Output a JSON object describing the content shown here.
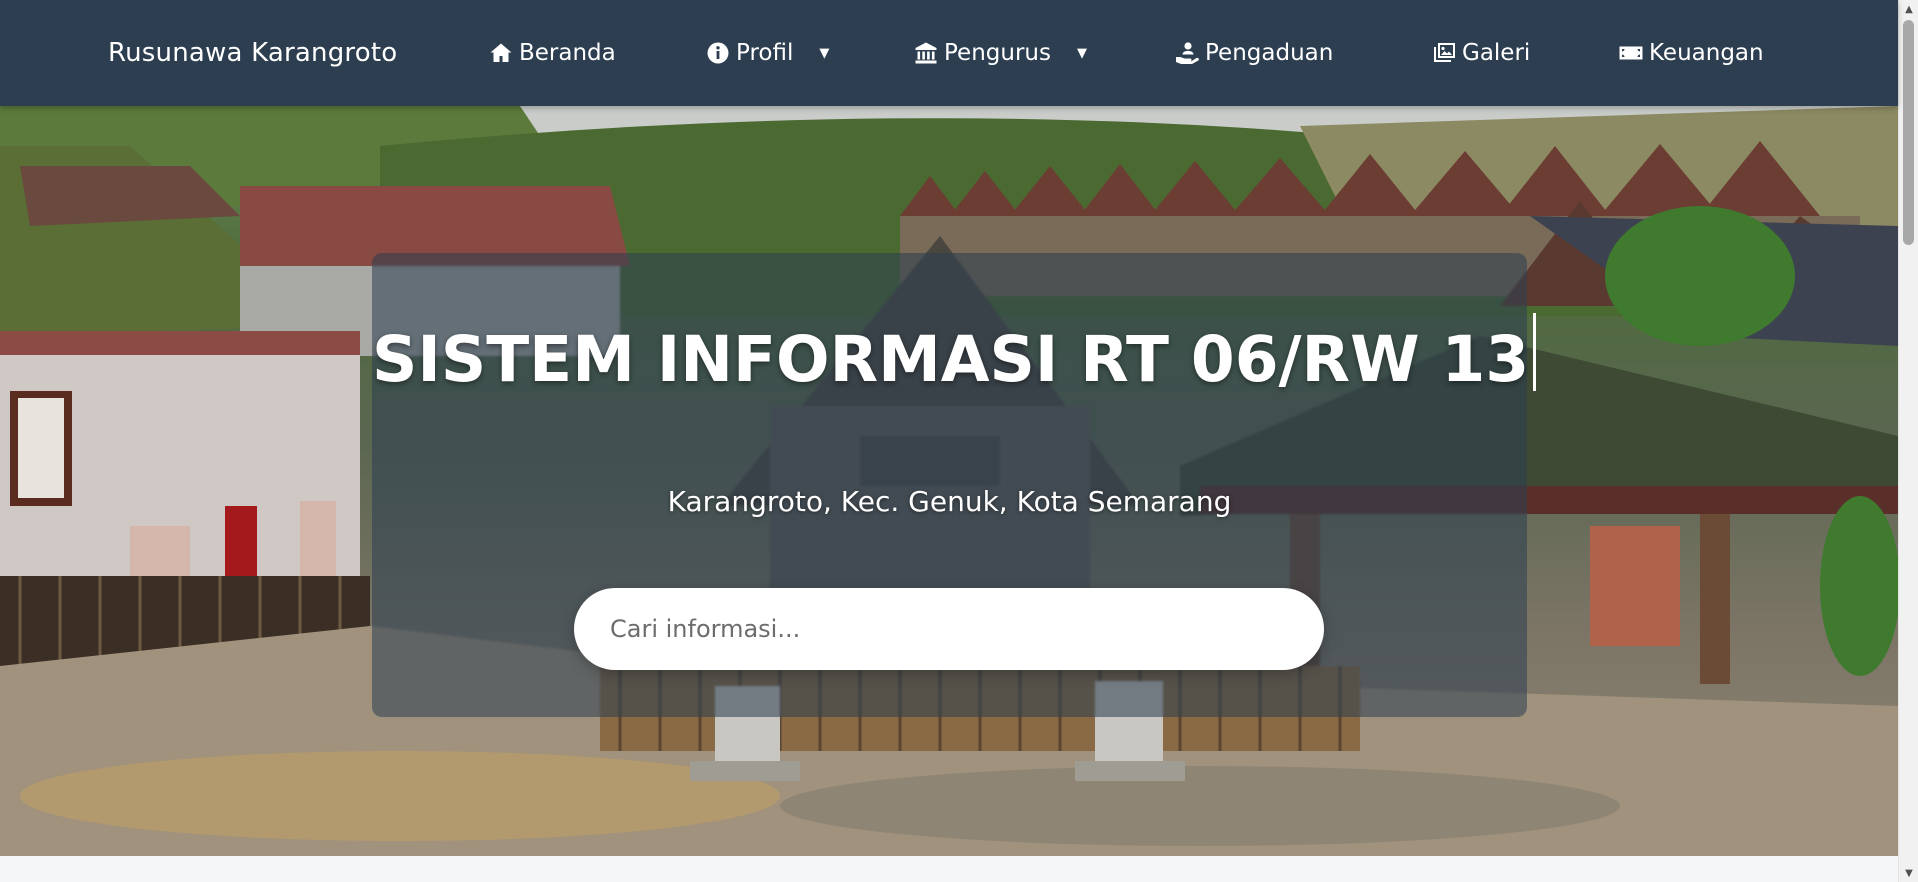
{
  "navbar": {
    "brand": "Rusunawa Karangroto",
    "items": [
      {
        "label": "Beranda",
        "icon": "home-icon"
      },
      {
        "label": "Profil",
        "icon": "info-icon",
        "has_dropdown": true
      },
      {
        "label": "Pengurus",
        "icon": "institution-icon",
        "has_dropdown": true
      },
      {
        "label": "Pengaduan",
        "icon": "hand-holding-user-icon"
      },
      {
        "label": "Galeri",
        "icon": "images-icon"
      },
      {
        "label": "Keuangan",
        "icon": "money-bill-icon"
      }
    ],
    "caret": "▼",
    "background_color": "#2c3e50"
  },
  "hero": {
    "title": "SISTEM INFORMASI RT 06/RW 13",
    "subtitle": "Karangroto, Kec. Genuk, Kota Semarang",
    "search": {
      "placeholder": "Cari informasi...",
      "value": ""
    }
  },
  "scrollbar": {
    "up_arrow": "▲",
    "down_arrow": "▼"
  }
}
